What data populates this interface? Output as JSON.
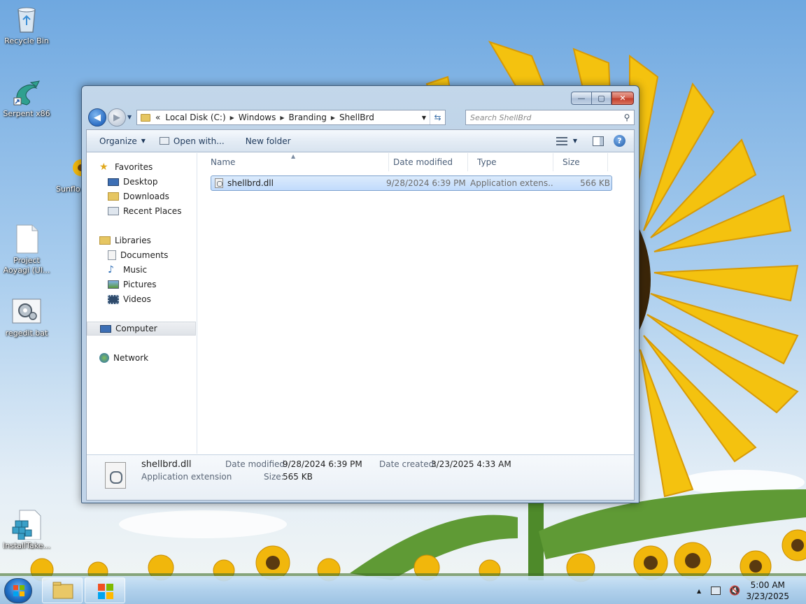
{
  "desktop": {
    "icons": [
      {
        "label": "Recycle Bin"
      },
      {
        "label": "Serpent x86"
      },
      {
        "label": "Sunflo"
      },
      {
        "label": "Project Aoyagi (Ul..."
      },
      {
        "label": "regedit.bat"
      },
      {
        "label": "InstallTake..."
      }
    ]
  },
  "window": {
    "title": "ShellBrd",
    "buttons": {
      "minimize": "—",
      "maximize": "▢",
      "close": "✕"
    },
    "breadcrumb": [
      "Local Disk (C:)",
      "Windows",
      "Branding",
      "ShellBrd"
    ],
    "breadcrumb_overflow": "«",
    "search_placeholder": "Search ShellBrd"
  },
  "toolbar": {
    "organize": "Organize",
    "open_with": "Open with...",
    "new_folder": "New folder",
    "help": "?"
  },
  "nav_pane": {
    "favorites": "Favorites",
    "favorite_items": [
      "Desktop",
      "Downloads",
      "Recent Places"
    ],
    "libraries": "Libraries",
    "library_items": [
      "Documents",
      "Music",
      "Pictures",
      "Videos"
    ],
    "computer": "Computer",
    "network": "Network"
  },
  "file_list": {
    "columns": [
      "Name",
      "Date modified",
      "Type",
      "Size"
    ],
    "rows": [
      {
        "name": "shellbrd.dll",
        "date_modified": "9/28/2024 6:39 PM",
        "type": "Application extens...",
        "size": "566 KB"
      }
    ]
  },
  "details": {
    "name": "shellbrd.dll",
    "type": "Application extension",
    "date_modified_label": "Date modified:",
    "date_modified": "9/28/2024 6:39 PM",
    "date_created_label": "Date created:",
    "date_created": "3/23/2025 4:33 AM",
    "size_label": "Size:",
    "size": "565 KB"
  },
  "taskbar": {
    "time": "5:00 AM",
    "date": "3/23/2025",
    "tray_arrow": "▲"
  },
  "colors": {
    "accent": "#2c6ec4",
    "close_button": "#c13c2a",
    "selection": "#c1dbfc"
  }
}
